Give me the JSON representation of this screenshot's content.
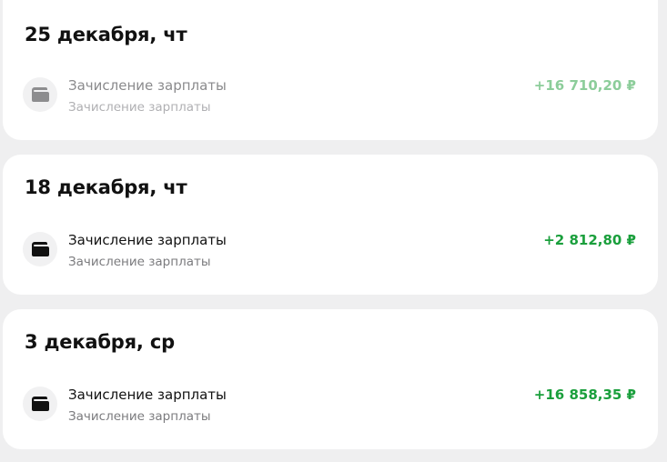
{
  "days": [
    {
      "date": "25 декабря, чт",
      "faded": true,
      "transaction": {
        "icon": "wallet-icon",
        "title": "Зачисление зарплаты",
        "subtitle": "Зачисление зарплаты",
        "amount": "+16 710,20 ₽"
      }
    },
    {
      "date": "18 декабря, чт",
      "faded": false,
      "transaction": {
        "icon": "wallet-icon",
        "title": "Зачисление зарплаты",
        "subtitle": "Зачисление зарплаты",
        "amount": "+2 812,80 ₽"
      }
    },
    {
      "date": "3 декабря, ср",
      "faded": false,
      "transaction": {
        "icon": "wallet-icon",
        "title": "Зачисление зарплаты",
        "subtitle": "Зачисление зарплаты",
        "amount": "+16 858,35 ₽"
      }
    }
  ],
  "colors": {
    "background": "#efeff0",
    "card": "#ffffff",
    "income_green": "#1a9f3c",
    "text_primary": "#111111",
    "text_secondary": "#7b7b7e"
  }
}
